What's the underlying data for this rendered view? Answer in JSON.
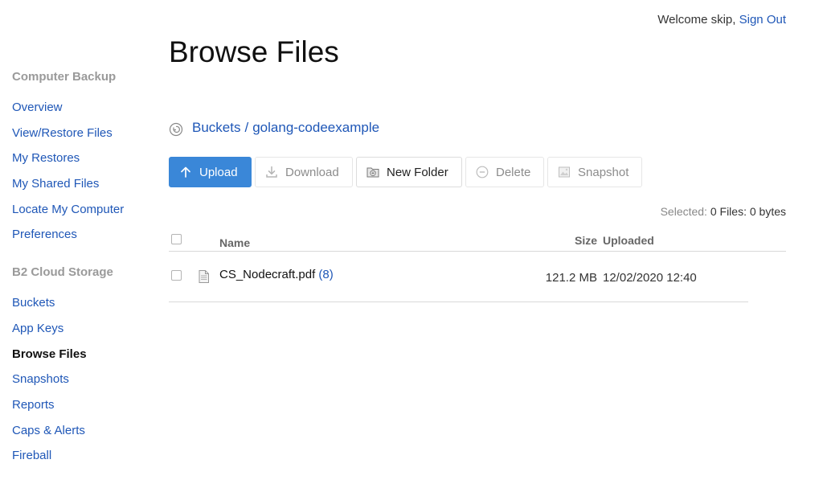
{
  "header": {
    "welcome": "Welcome skip,",
    "sign_out": "Sign Out"
  },
  "sidebar": {
    "sections": [
      {
        "title": "Computer Backup",
        "items": [
          "Overview",
          "View/Restore Files",
          "My Restores",
          "My Shared Files",
          "Locate My Computer",
          "Preferences"
        ]
      },
      {
        "title": "B2 Cloud Storage",
        "items": [
          "Buckets",
          "App Keys",
          "Browse Files",
          "Snapshots",
          "Reports",
          "Caps & Alerts",
          "Fireball"
        ]
      }
    ],
    "active_item": "Browse Files"
  },
  "main": {
    "title": "Browse Files",
    "breadcrumb": {
      "root": "Buckets",
      "separator": "/",
      "current": "golang-codeexample"
    },
    "toolbar": {
      "upload": "Upload",
      "download": "Download",
      "new_folder": "New Folder",
      "delete": "Delete",
      "snapshot": "Snapshot"
    },
    "selected": {
      "label": "Selected:",
      "value": "0 Files: 0 bytes"
    },
    "table": {
      "columns": {
        "name": "Name",
        "size": "Size",
        "uploaded": "Uploaded"
      },
      "rows": [
        {
          "name": "CS_Nodecraft.pdf",
          "versions": "(8)",
          "size": "121.2 MB",
          "uploaded": "12/02/2020 12:40"
        }
      ]
    }
  },
  "colors": {
    "link": "#1f57b7",
    "primary_button": "#3a87d8",
    "muted": "#9a9a9a"
  },
  "icons": {
    "breadcrumb": "history-back-icon",
    "upload": "arrow-up-icon",
    "download": "download-icon",
    "new_folder": "folder-plus-icon",
    "delete": "minus-circle-icon",
    "snapshot": "image-icon",
    "file": "document-icon"
  }
}
